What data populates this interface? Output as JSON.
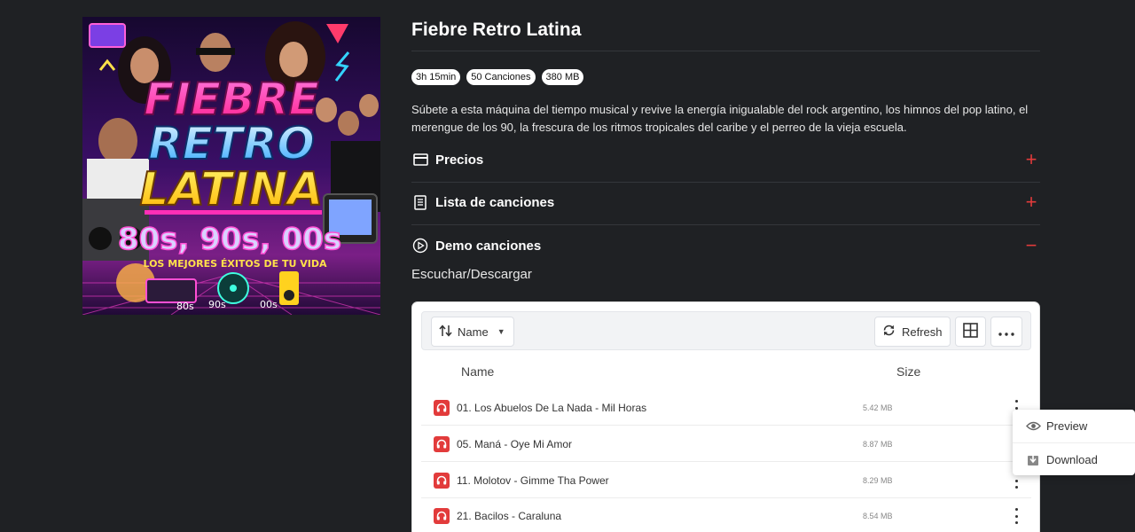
{
  "album": {
    "title": "Fiebre Retro Latina",
    "cover": {
      "line1": "FIEBRE",
      "line2": "RETRO",
      "line3": "LATINA",
      "decades": "80s, 90s, 00s",
      "tagline": "LOS MEJORES ÉXITOS DE TU VIDA",
      "labels": [
        "80s",
        "90s",
        "00s"
      ]
    },
    "badges": [
      "3h 15min",
      "50 Canciones",
      "380 MB"
    ],
    "description": "Súbete a esta máquina del tiempo musical y revive la energía inigualable del rock argentino, los himnos del pop latino, el merengue de los 90, la frescura de los ritmos tropicales del caribe y el perreo de la vieja escuela."
  },
  "accordion": [
    {
      "label": "Precios",
      "icon": "card-icon",
      "toggle": "+"
    },
    {
      "label": "Lista de canciones",
      "icon": "document-icon",
      "toggle": "+"
    },
    {
      "label": "Demo canciones",
      "icon": "play-circle-icon",
      "toggle": "−"
    }
  ],
  "demo": {
    "subheading": "Escuchar/Descargar",
    "toolbar": {
      "sort_label": "Name",
      "refresh_label": "Refresh"
    },
    "columns": {
      "name": "Name",
      "size": "Size"
    },
    "files": [
      {
        "name": "01. Los Abuelos De La Nada - Mil Horas",
        "size": "5.42 MB"
      },
      {
        "name": "05. Maná - Oye Mi Amor",
        "size": "8.87 MB"
      },
      {
        "name": "11. Molotov - Gimme Tha Power",
        "size": "8.29 MB"
      },
      {
        "name": "21. Bacilos - Caraluna",
        "size": "8.54 MB"
      }
    ],
    "context_menu": {
      "preview": "Preview",
      "download": "Download"
    }
  },
  "colors": {
    "accent": "#e23b3b",
    "background": "#1f2124"
  }
}
